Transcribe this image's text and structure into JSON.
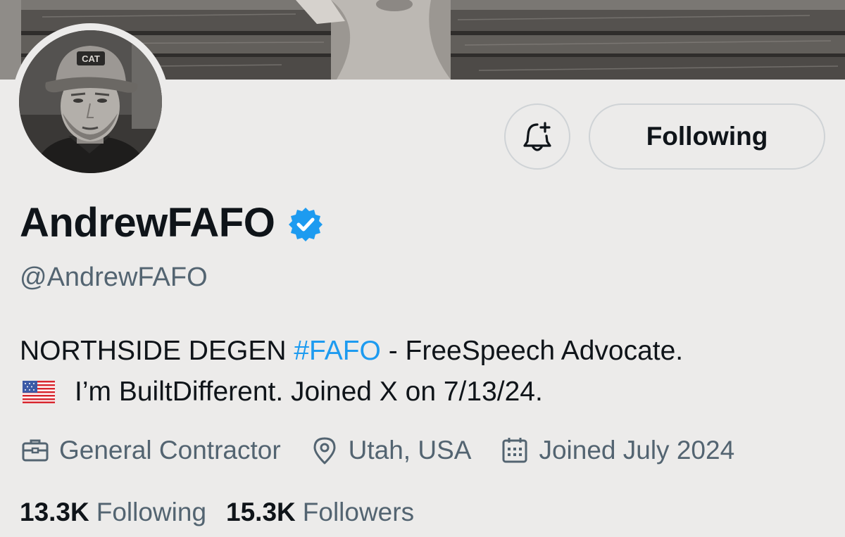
{
  "profile": {
    "display_name": "AndrewFAFO",
    "handle": "@AndrewFAFO",
    "verified": true,
    "bio": {
      "line1_prefix": "NORTHSIDE DEGEN",
      "line1_hashtag": "#FAFO",
      "line1_suffix": "- FreeSpeech Advocate.",
      "line2": "I’m BuiltDifferent. Joined X on 7/13/24."
    },
    "meta": {
      "occupation": "General Contractor",
      "location": "Utah, USA",
      "joined": "Joined July 2024"
    },
    "counts": {
      "following_value": "13.3K",
      "following_label": "Following",
      "followers_value": "15.3K",
      "followers_label": "Followers"
    }
  },
  "actions": {
    "following_button_label": "Following",
    "notify_button_icon": "bell-plus-icon"
  },
  "avatar": {
    "cap_text": "CAT"
  },
  "colors": {
    "background": "#ecebea",
    "text_primary": "#0f1419",
    "text_secondary": "#536471",
    "accent": "#1d9bf0",
    "verified_badge": "#1d9bf0",
    "button_border": "#cfd3d6"
  }
}
